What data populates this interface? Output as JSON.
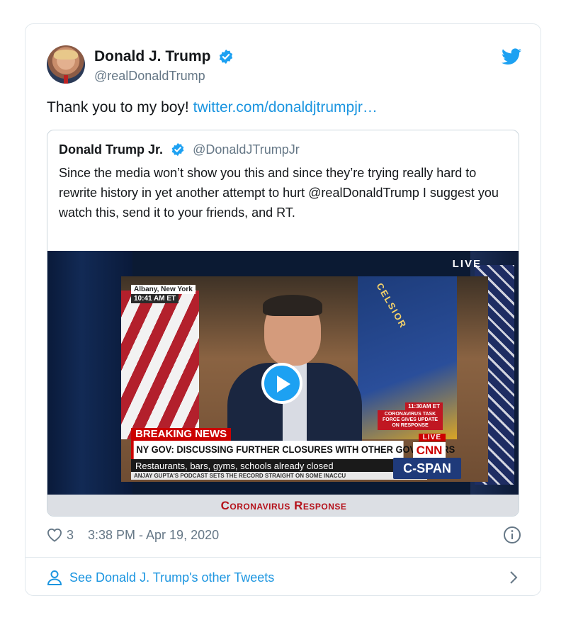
{
  "tweet": {
    "display_name": "Donald J. Trump",
    "handle": "@realDonaldTrump",
    "text": "Thank you to my boy! ",
    "link_text": "twitter.com/donaldjtrumpjr…",
    "likes": "3",
    "timestamp": "3:38 PM - Apr 19, 2020"
  },
  "quoted": {
    "display_name": "Donald Trump Jr.",
    "handle": "@DonaldJTrumpJr",
    "text": "Since the media won’t show you this and since they’re trying really hard to rewrite history in yet another attempt to hurt @realDonaldTrump I suggest you watch this, send it to your friends, and RT.",
    "video": {
      "live_label": "LIVE",
      "location": "Albany, New York",
      "time_left": "10:41 AM ET",
      "time_right": "11:30AM ET",
      "task_force": "CORONAVIRUS TASK FORCE GIVES UPDATE ON RESPONSE",
      "breaking": "BREAKING NEWS",
      "live_badge": "LIVE",
      "headline": "NY GOV: DISCUSSING FURTHER CLOSURES WITH OTHER GOVERNORS",
      "subline": "Restaurants, bars, gyms, schools already closed",
      "ticker": "ANJAY GUPTA'S PODCAST SETS THE RECORD STRAIGHT ON SOME INACCU",
      "network": "CNN",
      "cspan": "C-SPAN",
      "flag_text": "CELSIOR",
      "caption": "Coronavirus Response"
    }
  },
  "footer": {
    "see_more": "See Donald J. Trump's other Tweets"
  },
  "colors": {
    "accent": "#1b95e0",
    "verified": "#1da1f2",
    "secondary_text": "#657786",
    "border": "#e1e8ed"
  },
  "icons": {
    "avatar": "avatar",
    "verified": "verified-badge-icon",
    "brand": "twitter-bird-icon",
    "play": "play-icon",
    "like": "heart-icon",
    "info": "info-icon",
    "profile": "person-icon",
    "chevron": "chevron-right-icon"
  }
}
